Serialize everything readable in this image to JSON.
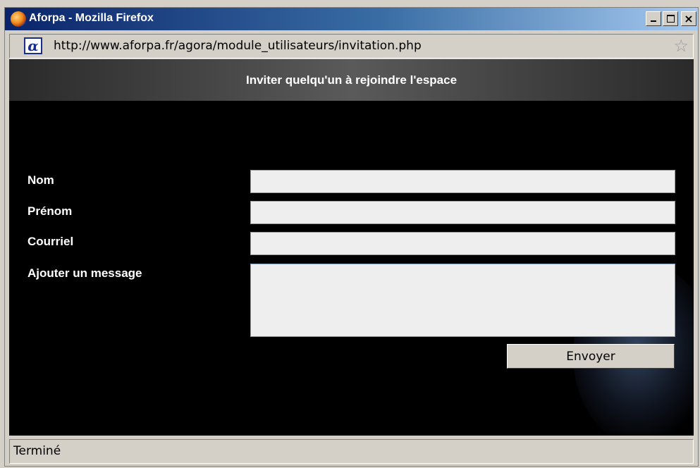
{
  "window": {
    "title": "Aforpa - Mozilla Firefox",
    "controls": {
      "minimize": "_",
      "maximize": "□",
      "close": "×"
    }
  },
  "address_bar": {
    "site_icon_glyph": "α",
    "url": "http://www.aforpa.fr/agora/module_utilisateurs/invitation.php",
    "bookmark_star": "☆"
  },
  "popup": {
    "header_title": "Inviter quelqu'un à rejoindre l'espace",
    "fields": {
      "nom": {
        "label": "Nom",
        "value": ""
      },
      "prenom": {
        "label": "Prénom",
        "value": ""
      },
      "courriel": {
        "label": "Courriel",
        "value": ""
      },
      "message": {
        "label": "Ajouter un message",
        "value": ""
      }
    },
    "submit_label": "Envoyer"
  },
  "status_bar": {
    "text": "Terminé"
  },
  "colors": {
    "titlebar_start": "#0a246a",
    "titlebar_end": "#a6caf0",
    "page_background": "#000000",
    "input_background": "#eeeeee",
    "chrome": "#d4d0c8"
  }
}
